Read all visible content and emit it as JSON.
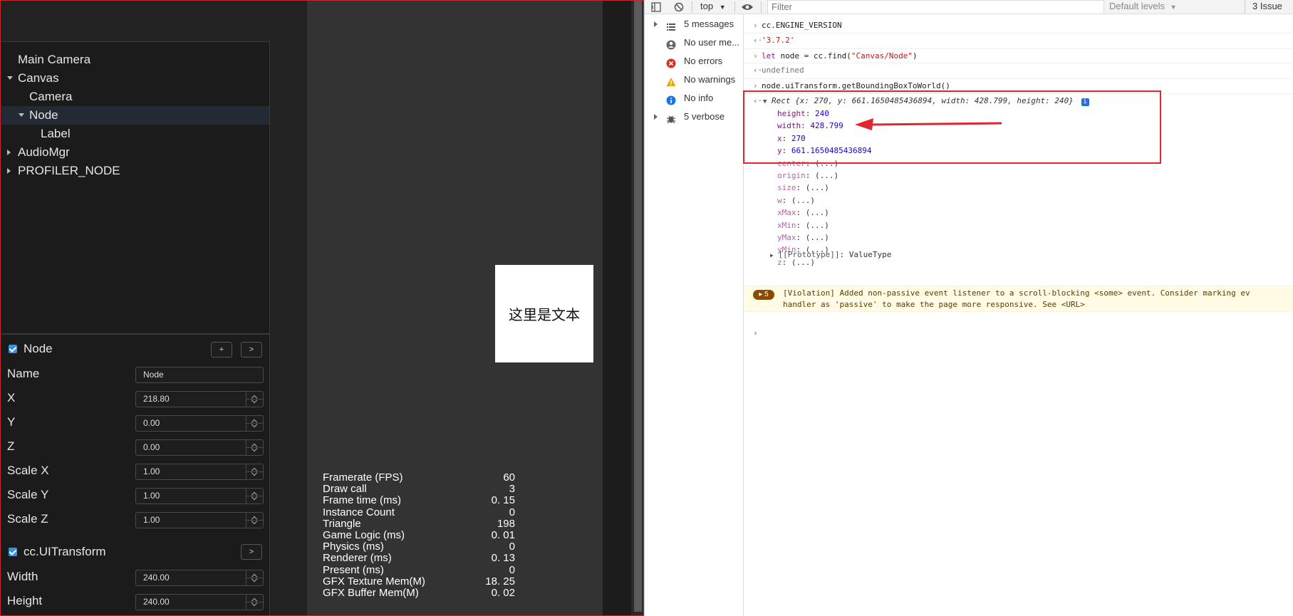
{
  "hierarchy": {
    "items": [
      {
        "label": "Main Camera",
        "arrow": "none"
      },
      {
        "label": "Canvas",
        "arrow": "down"
      },
      {
        "label": "Camera",
        "arrow": "none"
      },
      {
        "label": "Node",
        "arrow": "down"
      },
      {
        "label": "Label",
        "arrow": "none"
      },
      {
        "label": "AudioMgr",
        "arrow": "right"
      },
      {
        "label": "PROFILER_NODE",
        "arrow": "right"
      }
    ]
  },
  "inspector": {
    "node_title": "Node",
    "add_btn": "+",
    "more_btn": ">",
    "fields": [
      {
        "label": "Name",
        "value": "Node",
        "spinner": false
      },
      {
        "label": "X",
        "value": "218.80",
        "spinner": true
      },
      {
        "label": "Y",
        "value": "0.00",
        "spinner": true
      },
      {
        "label": "Z",
        "value": "0.00",
        "spinner": true
      },
      {
        "label": "Scale X",
        "value": "1.00",
        "spinner": true
      },
      {
        "label": "Scale Y",
        "value": "1.00",
        "spinner": true
      },
      {
        "label": "Scale Z",
        "value": "1.00",
        "spinner": true
      }
    ],
    "uitransform_title": "cc.UITransform",
    "uitransform_btn": ">",
    "ui_fields": [
      {
        "label": "Width",
        "value": "240.00"
      },
      {
        "label": "Height",
        "value": "240.00"
      }
    ]
  },
  "scene": {
    "label_text": "这里是文本"
  },
  "profiler": [
    {
      "name": "Framerate (FPS)",
      "value": "60"
    },
    {
      "name": "Draw call",
      "value": "3"
    },
    {
      "name": "Frame time (ms)",
      "value": "0. 15"
    },
    {
      "name": "Instance Count",
      "value": "0"
    },
    {
      "name": "Triangle",
      "value": "198"
    },
    {
      "name": "Game Logic (ms)",
      "value": "0. 01"
    },
    {
      "name": "Physics (ms)",
      "value": "0"
    },
    {
      "name": "Renderer (ms)",
      "value": "0. 13"
    },
    {
      "name": "Present (ms)",
      "value": "0"
    },
    {
      "name": "GFX Texture Mem(M)",
      "value": "18. 25"
    },
    {
      "name": "GFX Buffer Mem(M)",
      "value": "0. 02"
    }
  ],
  "devtools": {
    "context": "top",
    "filter_placeholder": "Filter",
    "levels": "Default levels",
    "issues": "3 Issue",
    "sidebar": [
      {
        "label": "5 messages",
        "icon": "list-icon",
        "arrow": true
      },
      {
        "label": "No user me...",
        "icon": "user-icon",
        "arrow": false
      },
      {
        "label": "No errors",
        "icon": "error-icon",
        "arrow": false
      },
      {
        "label": "No warnings",
        "icon": "warning-icon",
        "arrow": false
      },
      {
        "label": "No info",
        "icon": "info-icon",
        "arrow": false
      },
      {
        "label": "5 verbose",
        "icon": "bug-icon",
        "arrow": true
      }
    ],
    "console": {
      "cmd1": "cc.ENGINE_VERSION",
      "res1": "'3.7.2'",
      "cmd2_kw": "let",
      "cmd2_rest": " node = cc.find(",
      "cmd2_str": "\"Canvas/Node\"",
      "cmd2_end": ")",
      "res2": "undefined",
      "cmd3": "node.uiTransform.getBoundingBoxToWorld()",
      "rect_summary_head": "Rect ",
      "rect_summary_body": "{x: 270, y: 661.1650485436894, width: 428.799, height: 240}",
      "props": [
        {
          "key": "height",
          "value": "240",
          "dim": false
        },
        {
          "key": "width",
          "value": "428.799",
          "dim": false
        },
        {
          "key": "x",
          "value": "270",
          "dim": false
        },
        {
          "key": "y",
          "value": "661.1650485436894",
          "dim": false
        },
        {
          "key": "center",
          "value": "(...)",
          "dim": true
        },
        {
          "key": "origin",
          "value": "(...)",
          "dim": true
        },
        {
          "key": "size",
          "value": "(...)",
          "dim": true
        },
        {
          "key": "w",
          "value": "(...)",
          "dim": true
        },
        {
          "key": "xMax",
          "value": "(...)",
          "dim": true
        },
        {
          "key": "xMin",
          "value": "(...)",
          "dim": true
        },
        {
          "key": "yMax",
          "value": "(...)",
          "dim": true
        },
        {
          "key": "yMin",
          "value": "(...)",
          "dim": true
        },
        {
          "key": "z",
          "value": "(...)",
          "dim": true
        }
      ],
      "prototype_key": "[[Prototype]]",
      "prototype_val": "ValueType",
      "violation_count": "5",
      "violation_line1": "[Violation] Added non-passive event listener to a scroll-blocking <some> event. Consider marking ev",
      "violation_line2": "handler as 'passive' to make the page more responsive. See <URL>"
    }
  },
  "colors": {
    "highlight": "#e0262f",
    "checkbox": "#3b8fe0"
  }
}
